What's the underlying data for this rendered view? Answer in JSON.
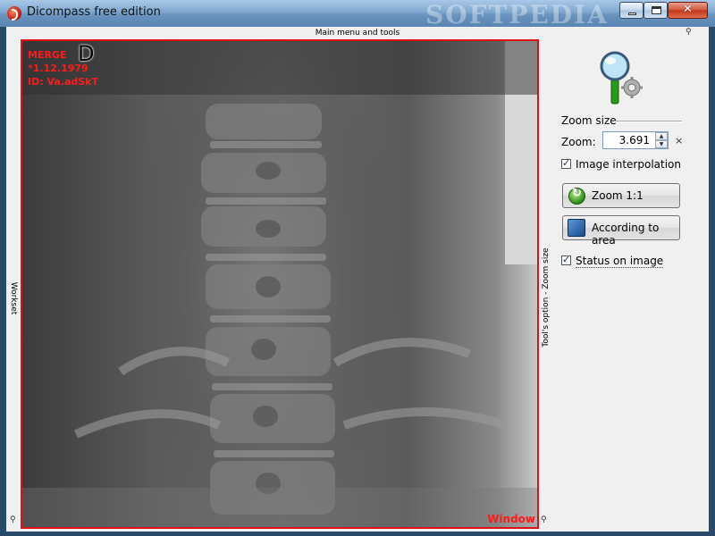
{
  "window": {
    "title": "Dicompass free edition",
    "watermark": "SOFTPEDIA"
  },
  "menu": {
    "label": "Main menu and tools"
  },
  "panels": {
    "left_label": "Workset",
    "right_label": "Tool's option - Zoom size"
  },
  "image": {
    "overlay_lines": [
      "MERGE",
      "*1.12.1979",
      "ID: Va.adSkT"
    ],
    "orientation_letter": "D",
    "window_label": "Window"
  },
  "tools": {
    "section_title": "Zoom size",
    "zoom_label": "Zoom:",
    "zoom_value": "3.691",
    "zoom_suffix": "×",
    "interpolation_label": "Image interpolation",
    "zoom11_label": "Zoom 1:1",
    "according_area_label": "According to area",
    "status_label": "Status on image"
  },
  "colors": {
    "overlay_red": "#ff1a1a",
    "frame_red": "#e0101a"
  }
}
